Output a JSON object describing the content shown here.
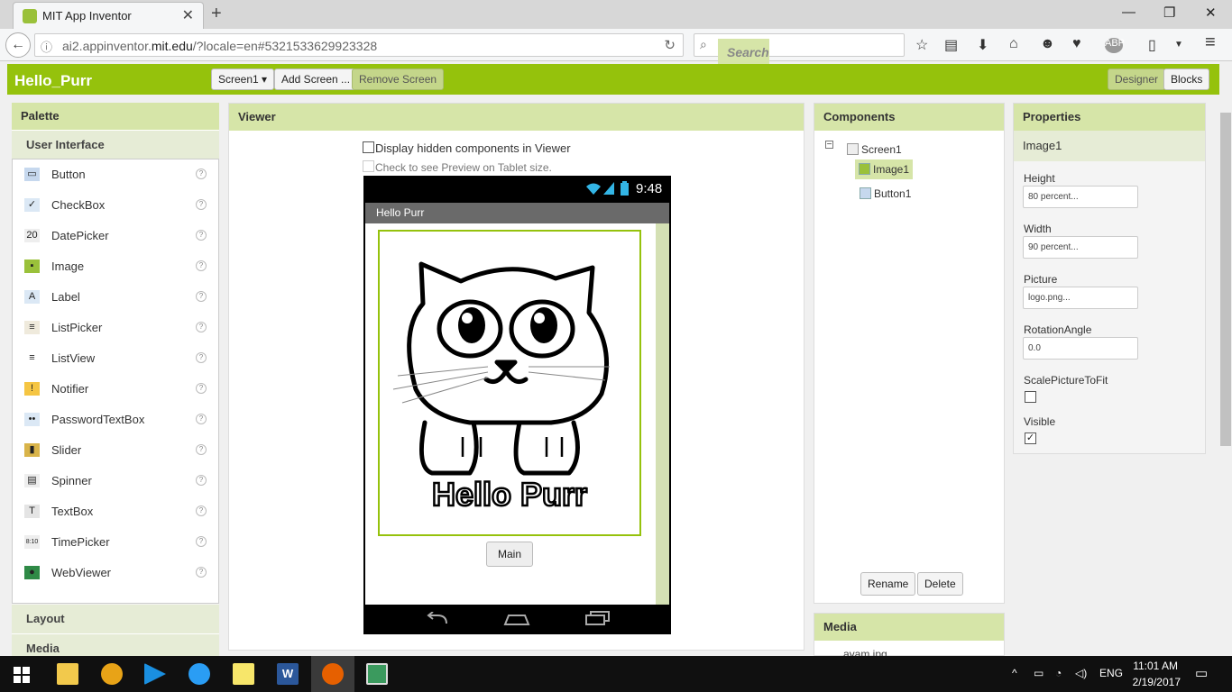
{
  "browser": {
    "tab_title": "MIT App Inventor",
    "url_prefix": "ai2.appinventor.",
    "url_domain": "mit.edu",
    "url_rest": "/?locale=en#5321533629923328",
    "search_placeholder": "Search"
  },
  "header": {
    "project_name": "Hello_Purr",
    "screen_select": "Screen1 ▾",
    "add_screen": "Add Screen ...",
    "remove_screen": "Remove Screen",
    "designer": "Designer",
    "blocks": "Blocks"
  },
  "palette": {
    "title": "Palette",
    "category": "User Interface",
    "items": [
      {
        "label": "Button",
        "icon": "button-icon"
      },
      {
        "label": "CheckBox",
        "icon": "checkbox-icon"
      },
      {
        "label": "DatePicker",
        "icon": "datepicker-icon"
      },
      {
        "label": "Image",
        "icon": "image-icon"
      },
      {
        "label": "Label",
        "icon": "label-icon"
      },
      {
        "label": "ListPicker",
        "icon": "listpicker-icon"
      },
      {
        "label": "ListView",
        "icon": "listview-icon"
      },
      {
        "label": "Notifier",
        "icon": "notifier-icon"
      },
      {
        "label": "PasswordTextBox",
        "icon": "password-icon"
      },
      {
        "label": "Slider",
        "icon": "slider-icon"
      },
      {
        "label": "Spinner",
        "icon": "spinner-icon"
      },
      {
        "label": "TextBox",
        "icon": "textbox-icon"
      },
      {
        "label": "TimePicker",
        "icon": "timepicker-icon"
      },
      {
        "label": "WebViewer",
        "icon": "webviewer-icon"
      }
    ],
    "layout": "Layout",
    "media": "Media"
  },
  "viewer": {
    "title": "Viewer",
    "hidden_components": "Display hidden components in Viewer",
    "tablet_preview": "Check to see Preview on Tablet size.",
    "time": "9:48",
    "app_title": "Hello Purr",
    "image_text": "Hello Purr",
    "main_button": "Main"
  },
  "components": {
    "title": "Components",
    "screen": "Screen1",
    "image": "Image1",
    "button": "Button1",
    "rename": "Rename",
    "delete": "Delete"
  },
  "media": {
    "title": "Media",
    "file": "ayam.jpg"
  },
  "properties": {
    "title": "Properties",
    "component": "Image1",
    "height_label": "Height",
    "height_value": "80 percent...",
    "width_label": "Width",
    "width_value": "90 percent...",
    "picture_label": "Picture",
    "picture_value": "logo.png...",
    "rotation_label": "RotationAngle",
    "rotation_value": "0.0",
    "scale_label": "ScalePictureToFit",
    "visible_label": "Visible"
  },
  "taskbar": {
    "lang": "ENG",
    "time": "11:01 AM",
    "date": "2/19/2017"
  },
  "colors": {
    "accent": "#95c20c",
    "panel_header": "#d6e5a8"
  }
}
